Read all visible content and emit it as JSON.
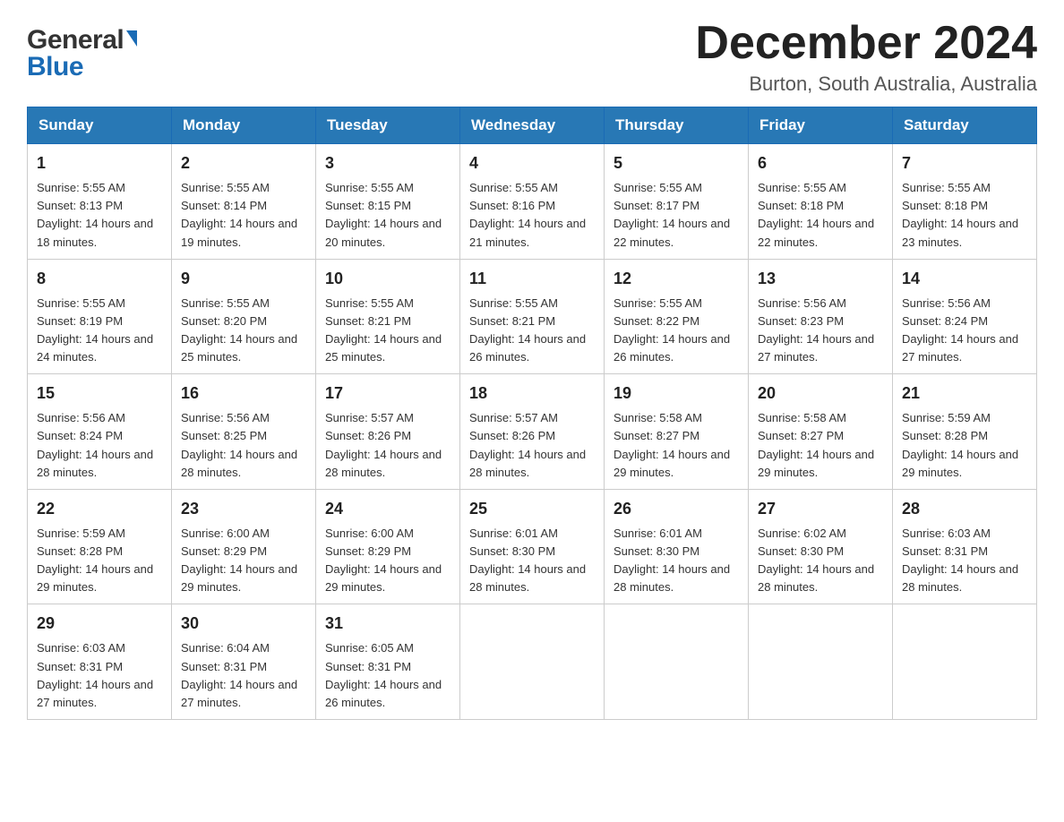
{
  "header": {
    "logo_general": "General",
    "logo_blue": "Blue",
    "month_title": "December 2024",
    "subtitle": "Burton, South Australia, Australia"
  },
  "weekdays": [
    "Sunday",
    "Monday",
    "Tuesday",
    "Wednesday",
    "Thursday",
    "Friday",
    "Saturday"
  ],
  "weeks": [
    [
      {
        "day": "1",
        "sunrise": "Sunrise: 5:55 AM",
        "sunset": "Sunset: 8:13 PM",
        "daylight": "Daylight: 14 hours and 18 minutes."
      },
      {
        "day": "2",
        "sunrise": "Sunrise: 5:55 AM",
        "sunset": "Sunset: 8:14 PM",
        "daylight": "Daylight: 14 hours and 19 minutes."
      },
      {
        "day": "3",
        "sunrise": "Sunrise: 5:55 AM",
        "sunset": "Sunset: 8:15 PM",
        "daylight": "Daylight: 14 hours and 20 minutes."
      },
      {
        "day": "4",
        "sunrise": "Sunrise: 5:55 AM",
        "sunset": "Sunset: 8:16 PM",
        "daylight": "Daylight: 14 hours and 21 minutes."
      },
      {
        "day": "5",
        "sunrise": "Sunrise: 5:55 AM",
        "sunset": "Sunset: 8:17 PM",
        "daylight": "Daylight: 14 hours and 22 minutes."
      },
      {
        "day": "6",
        "sunrise": "Sunrise: 5:55 AM",
        "sunset": "Sunset: 8:18 PM",
        "daylight": "Daylight: 14 hours and 22 minutes."
      },
      {
        "day": "7",
        "sunrise": "Sunrise: 5:55 AM",
        "sunset": "Sunset: 8:18 PM",
        "daylight": "Daylight: 14 hours and 23 minutes."
      }
    ],
    [
      {
        "day": "8",
        "sunrise": "Sunrise: 5:55 AM",
        "sunset": "Sunset: 8:19 PM",
        "daylight": "Daylight: 14 hours and 24 minutes."
      },
      {
        "day": "9",
        "sunrise": "Sunrise: 5:55 AM",
        "sunset": "Sunset: 8:20 PM",
        "daylight": "Daylight: 14 hours and 25 minutes."
      },
      {
        "day": "10",
        "sunrise": "Sunrise: 5:55 AM",
        "sunset": "Sunset: 8:21 PM",
        "daylight": "Daylight: 14 hours and 25 minutes."
      },
      {
        "day": "11",
        "sunrise": "Sunrise: 5:55 AM",
        "sunset": "Sunset: 8:21 PM",
        "daylight": "Daylight: 14 hours and 26 minutes."
      },
      {
        "day": "12",
        "sunrise": "Sunrise: 5:55 AM",
        "sunset": "Sunset: 8:22 PM",
        "daylight": "Daylight: 14 hours and 26 minutes."
      },
      {
        "day": "13",
        "sunrise": "Sunrise: 5:56 AM",
        "sunset": "Sunset: 8:23 PM",
        "daylight": "Daylight: 14 hours and 27 minutes."
      },
      {
        "day": "14",
        "sunrise": "Sunrise: 5:56 AM",
        "sunset": "Sunset: 8:24 PM",
        "daylight": "Daylight: 14 hours and 27 minutes."
      }
    ],
    [
      {
        "day": "15",
        "sunrise": "Sunrise: 5:56 AM",
        "sunset": "Sunset: 8:24 PM",
        "daylight": "Daylight: 14 hours and 28 minutes."
      },
      {
        "day": "16",
        "sunrise": "Sunrise: 5:56 AM",
        "sunset": "Sunset: 8:25 PM",
        "daylight": "Daylight: 14 hours and 28 minutes."
      },
      {
        "day": "17",
        "sunrise": "Sunrise: 5:57 AM",
        "sunset": "Sunset: 8:26 PM",
        "daylight": "Daylight: 14 hours and 28 minutes."
      },
      {
        "day": "18",
        "sunrise": "Sunrise: 5:57 AM",
        "sunset": "Sunset: 8:26 PM",
        "daylight": "Daylight: 14 hours and 28 minutes."
      },
      {
        "day": "19",
        "sunrise": "Sunrise: 5:58 AM",
        "sunset": "Sunset: 8:27 PM",
        "daylight": "Daylight: 14 hours and 29 minutes."
      },
      {
        "day": "20",
        "sunrise": "Sunrise: 5:58 AM",
        "sunset": "Sunset: 8:27 PM",
        "daylight": "Daylight: 14 hours and 29 minutes."
      },
      {
        "day": "21",
        "sunrise": "Sunrise: 5:59 AM",
        "sunset": "Sunset: 8:28 PM",
        "daylight": "Daylight: 14 hours and 29 minutes."
      }
    ],
    [
      {
        "day": "22",
        "sunrise": "Sunrise: 5:59 AM",
        "sunset": "Sunset: 8:28 PM",
        "daylight": "Daylight: 14 hours and 29 minutes."
      },
      {
        "day": "23",
        "sunrise": "Sunrise: 6:00 AM",
        "sunset": "Sunset: 8:29 PM",
        "daylight": "Daylight: 14 hours and 29 minutes."
      },
      {
        "day": "24",
        "sunrise": "Sunrise: 6:00 AM",
        "sunset": "Sunset: 8:29 PM",
        "daylight": "Daylight: 14 hours and 29 minutes."
      },
      {
        "day": "25",
        "sunrise": "Sunrise: 6:01 AM",
        "sunset": "Sunset: 8:30 PM",
        "daylight": "Daylight: 14 hours and 28 minutes."
      },
      {
        "day": "26",
        "sunrise": "Sunrise: 6:01 AM",
        "sunset": "Sunset: 8:30 PM",
        "daylight": "Daylight: 14 hours and 28 minutes."
      },
      {
        "day": "27",
        "sunrise": "Sunrise: 6:02 AM",
        "sunset": "Sunset: 8:30 PM",
        "daylight": "Daylight: 14 hours and 28 minutes."
      },
      {
        "day": "28",
        "sunrise": "Sunrise: 6:03 AM",
        "sunset": "Sunset: 8:31 PM",
        "daylight": "Daylight: 14 hours and 28 minutes."
      }
    ],
    [
      {
        "day": "29",
        "sunrise": "Sunrise: 6:03 AM",
        "sunset": "Sunset: 8:31 PM",
        "daylight": "Daylight: 14 hours and 27 minutes."
      },
      {
        "day": "30",
        "sunrise": "Sunrise: 6:04 AM",
        "sunset": "Sunset: 8:31 PM",
        "daylight": "Daylight: 14 hours and 27 minutes."
      },
      {
        "day": "31",
        "sunrise": "Sunrise: 6:05 AM",
        "sunset": "Sunset: 8:31 PM",
        "daylight": "Daylight: 14 hours and 26 minutes."
      },
      null,
      null,
      null,
      null
    ]
  ]
}
